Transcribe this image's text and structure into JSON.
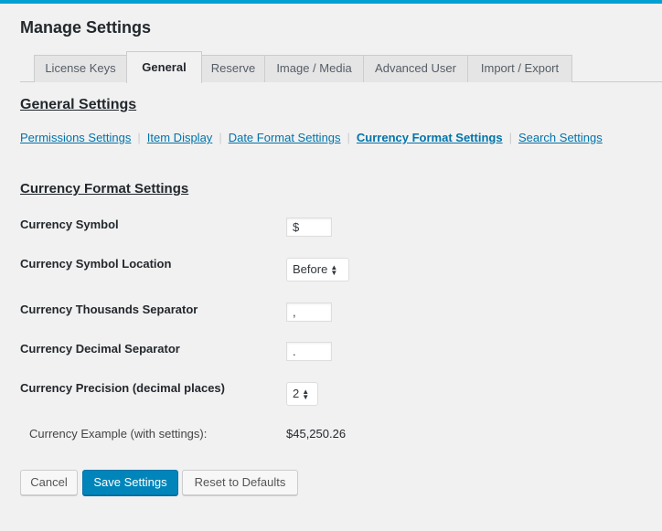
{
  "page": {
    "title": "Manage Settings"
  },
  "tabs": [
    {
      "label": "License Keys",
      "active": false
    },
    {
      "label": "General",
      "active": true
    },
    {
      "label": "Reserve",
      "active": false
    },
    {
      "label": "Image / Media",
      "active": false
    },
    {
      "label": "Advanced User",
      "active": false
    },
    {
      "label": "Import / Export",
      "active": false
    }
  ],
  "section": {
    "title": "General Settings"
  },
  "sublinks": [
    {
      "label": "Permissions Settings"
    },
    {
      "label": "Item Display"
    },
    {
      "label": "Date Format Settings"
    },
    {
      "label": "Currency Format Settings",
      "current": true
    },
    {
      "label": "Search Settings"
    }
  ],
  "currency": {
    "title": "Currency Format Settings",
    "symbol": {
      "label": "Currency Symbol",
      "value": "$"
    },
    "location": {
      "label": "Currency Symbol Location",
      "value": "Before"
    },
    "thousands": {
      "label": "Currency Thousands Separator",
      "value": ","
    },
    "decimal": {
      "label": "Currency Decimal Separator",
      "value": "."
    },
    "precision": {
      "label": "Currency Precision (decimal places)",
      "value": "2"
    },
    "example": {
      "label": "Currency Example (with settings):",
      "value": "$45,250.26"
    }
  },
  "buttons": {
    "cancel": "Cancel",
    "save": "Save Settings",
    "reset": "Reset to Defaults"
  },
  "colors": {
    "accent": "#00a0d2",
    "link": "#0073aa",
    "primary_button": "#0085ba"
  }
}
